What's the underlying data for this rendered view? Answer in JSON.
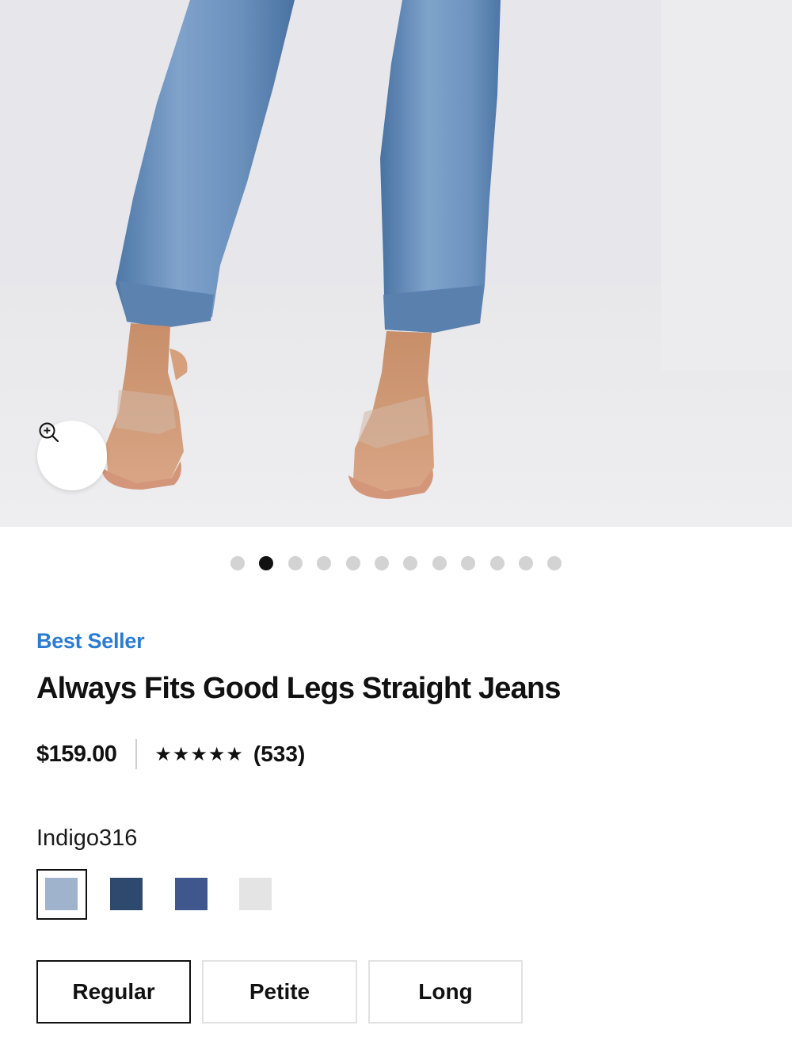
{
  "hero": {
    "image_alt": "Close-up of straight-leg jeans hem with clear strap sandals",
    "zoom_icon": "zoom-in-icon"
  },
  "carousel": {
    "total": 12,
    "active_index": 1
  },
  "product": {
    "badge": "Best Seller",
    "title": "Always Fits Good Legs Straight Jeans",
    "price": "$159.00",
    "stars": "★★★★★",
    "rating": 5,
    "review_count": "(533)"
  },
  "colors": {
    "selected_name": "Indigo316",
    "swatches": [
      {
        "name": "Indigo316",
        "color": "#9fb3cc",
        "selected": true
      },
      {
        "name": "dark-wash",
        "color": "#2d4a6e",
        "selected": false
      },
      {
        "name": "blue-wash",
        "color": "#3f578c",
        "selected": false
      },
      {
        "name": "light-grey",
        "color": "#e4e4e4",
        "selected": false
      }
    ]
  },
  "fits": {
    "options": [
      {
        "label": "Regular",
        "selected": true
      },
      {
        "label": "Petite",
        "selected": false
      },
      {
        "label": "Long",
        "selected": false
      }
    ]
  },
  "theme": {
    "accent": "#2b7bd0",
    "text": "#111111",
    "dot_inactive": "#d3d3d3"
  }
}
